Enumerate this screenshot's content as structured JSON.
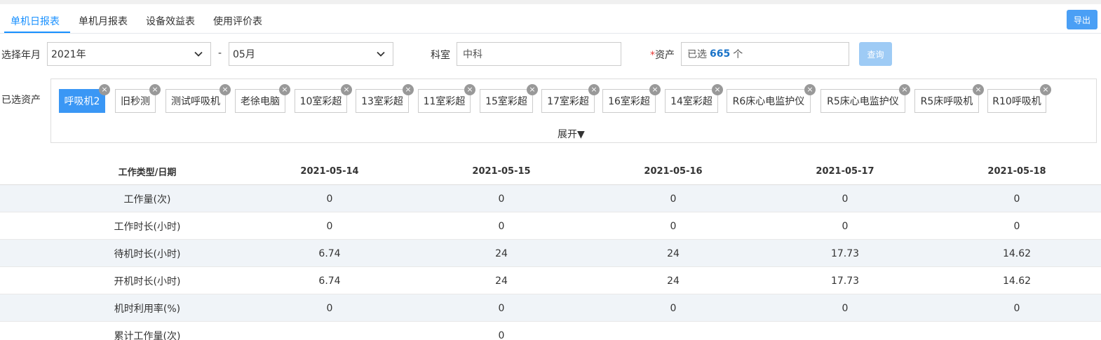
{
  "tabs": [
    {
      "label": "单机日报表",
      "active": true
    },
    {
      "label": "单机月报表",
      "active": false
    },
    {
      "label": "设备效益表",
      "active": false
    },
    {
      "label": "使用评价表",
      "active": false
    }
  ],
  "export_label": "导出",
  "filters": {
    "year_month_label": "选择年月",
    "year_value": "2021年",
    "separator": "-",
    "month_value": "05月",
    "dept_label": "科室",
    "dept_value": "中科",
    "asset_required_mark": "*",
    "asset_label": "资产",
    "asset_selected_prefix": "已选",
    "asset_selected_count": "665",
    "asset_selected_suffix": "个",
    "query_label": "查询"
  },
  "selected_assets": {
    "label": "已选资产",
    "chips": [
      {
        "label": "呼吸机2",
        "active": true
      },
      {
        "label": "旧秒测",
        "active": false
      },
      {
        "label": "测试呼吸机",
        "active": false
      },
      {
        "label": "老徐电脑",
        "active": false
      },
      {
        "label": "10室彩超",
        "active": false
      },
      {
        "label": "13室彩超",
        "active": false
      },
      {
        "label": "11室彩超",
        "active": false
      },
      {
        "label": "15室彩超",
        "active": false
      },
      {
        "label": "17室彩超",
        "active": false
      },
      {
        "label": "16室彩超",
        "active": false
      },
      {
        "label": "14室彩超",
        "active": false
      },
      {
        "label": "R6床心电监护仪",
        "active": false
      },
      {
        "label": "R5床心电监护仪",
        "active": false
      },
      {
        "label": "R5床呼吸机",
        "active": false
      },
      {
        "label": "R10呼吸机",
        "active": false
      }
    ],
    "remove_glyph": "×",
    "expand_label": "展开▼"
  },
  "table": {
    "headers": [
      "工作类型/日期",
      "2021-05-14",
      "2021-05-15",
      "2021-05-16",
      "2021-05-17",
      "2021-05-18"
    ],
    "rows": [
      [
        "工作量(次)",
        "0",
        "0",
        "0",
        "0",
        "0"
      ],
      [
        "工作时长(小时)",
        "0",
        "0",
        "0",
        "0",
        "0"
      ],
      [
        "待机时长(小时)",
        "6.74",
        "24",
        "24",
        "17.73",
        "14.62"
      ],
      [
        "开机时长(小时)",
        "6.74",
        "24",
        "24",
        "17.73",
        "14.62"
      ],
      [
        "机时利用率(%)",
        "0",
        "0",
        "0",
        "0",
        "0"
      ],
      [
        "累计工作量(次)",
        "",
        "0",
        "",
        "",
        ""
      ]
    ]
  },
  "colors": {
    "accent": "#1890ff",
    "button": "#4a9ff5",
    "chip_active": "#3a97f5",
    "row_stripe": "#f0f4f8"
  }
}
